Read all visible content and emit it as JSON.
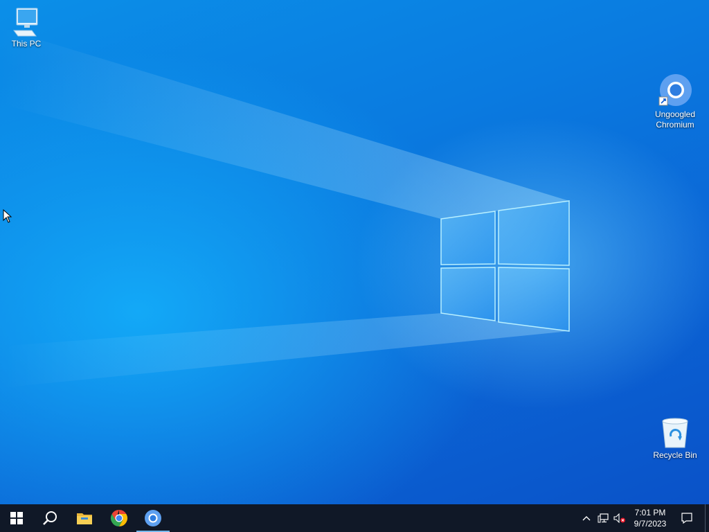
{
  "desktop": {
    "icons": [
      {
        "label": "This PC",
        "icon": "computer-icon"
      },
      {
        "label_line1": "Ungoogled",
        "label_line2": "Chromium",
        "icon": "chromium-icon"
      },
      {
        "label": "Recycle Bin",
        "icon": "recycle-bin-icon"
      }
    ]
  },
  "taskbar": {
    "pinned": [
      {
        "name": "start-button",
        "icon": "windows-logo-icon"
      },
      {
        "name": "search-button",
        "icon": "search-icon"
      },
      {
        "name": "file-explorer-button",
        "icon": "folder-icon"
      },
      {
        "name": "chrome-button",
        "icon": "chrome-icon"
      },
      {
        "name": "chromium-button",
        "icon": "chromium-icon"
      }
    ],
    "tray": {
      "icons": [
        "chevron-up-icon",
        "network-icon",
        "volume-muted-icon"
      ],
      "time": "7:01 PM",
      "date": "9/7/2023",
      "notification_icon": "action-center-icon"
    }
  },
  "colors": {
    "taskbar": "#101827",
    "wallpaper_accent": "#0b8fe8"
  }
}
